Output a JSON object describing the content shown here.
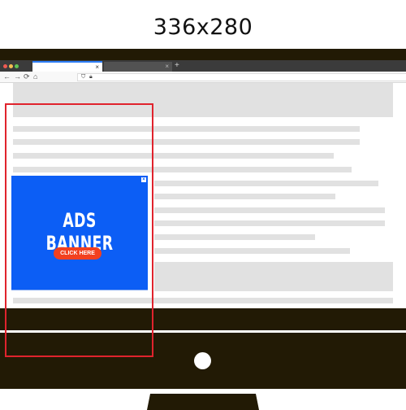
{
  "caption": "336x280",
  "browser": {
    "tabs": [
      {
        "close_icon": "×",
        "active": true
      },
      {
        "close_icon": "×",
        "active": false
      }
    ],
    "new_tab_icon": "+",
    "nav_icons": {
      "back": "←",
      "forward": "→",
      "reload": "⟳",
      "home": "⌂"
    },
    "url_icons": {
      "shield": "⛉",
      "lock": "🔒︎"
    }
  },
  "ad": {
    "title": "ADS BANNER",
    "button_label": "CLICK HERE",
    "close_icon": "×",
    "background_color": "#0c5ef5",
    "button_color": "#f2401f"
  },
  "colors": {
    "monitor": "#221a05",
    "placeholder": "#e1e1e1",
    "highlight": "#e0232d"
  }
}
